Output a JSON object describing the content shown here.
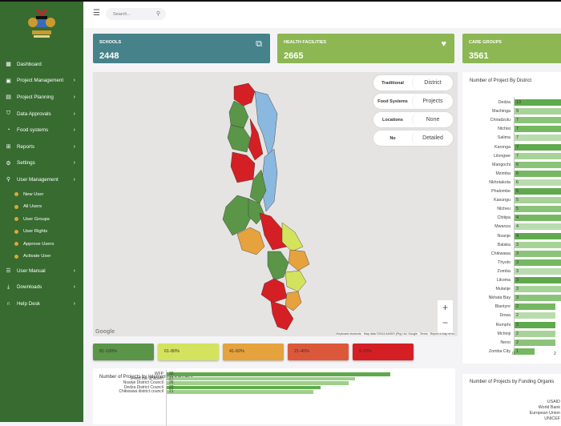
{
  "sidebar": {
    "items": [
      {
        "label": "Dashboard",
        "icon": "grid-icon",
        "glyph": "▦",
        "chev": false
      },
      {
        "label": "Project Management",
        "icon": "folder-icon",
        "glyph": "▣",
        "chev": true
      },
      {
        "label": "Project Planning",
        "icon": "calendar-icon",
        "glyph": "▤",
        "chev": true
      },
      {
        "label": "Data Approvals",
        "icon": "shield-icon",
        "glyph": "⛉",
        "chev": true
      },
      {
        "label": "Food systems",
        "icon": "food-icon",
        "glyph": "◔",
        "chev": true
      },
      {
        "label": "Reports",
        "icon": "reports-icon",
        "glyph": "⊞",
        "chev": true
      },
      {
        "label": "Settings",
        "icon": "gear-icon",
        "glyph": "⚙",
        "chev": true
      },
      {
        "label": "User Management",
        "icon": "user-icon",
        "glyph": "⚲",
        "chev": true
      }
    ],
    "sub_items": [
      "New User",
      "All Users",
      "User Groups",
      "User Rights",
      "Approve Users",
      "Activate User"
    ],
    "bottom_items": [
      {
        "label": "User Manual",
        "icon": "manual-icon",
        "glyph": "☰"
      },
      {
        "label": "Downloads",
        "icon": "download-icon",
        "glyph": "⤓"
      },
      {
        "label": "Help Desk",
        "icon": "headset-icon",
        "glyph": "∩"
      }
    ]
  },
  "header": {
    "search_placeholder": "Search..."
  },
  "cards": [
    {
      "title": "SCHOOLS",
      "value": "2448",
      "color": "#468289"
    },
    {
      "title": "HEALTH FACILITIES",
      "value": "2665",
      "color": "#8cb752"
    },
    {
      "title": "CARE GROUPS",
      "value": "3561",
      "color": "#8cb752"
    }
  ],
  "map": {
    "toggles": [
      [
        "Traditional",
        "District"
      ],
      [
        "Food Systems",
        "Projects"
      ],
      [
        "Locations",
        "None"
      ],
      [
        "No",
        "Detailed"
      ]
    ],
    "attribution": "Keyboard shortcuts   Map data ©2024 AfriGIS (Pty) Ltd, Google   Terms   Report a map error",
    "google": "Google",
    "zoom_in": "+",
    "zoom_out": "−"
  },
  "legend": [
    {
      "label": "81-100%",
      "color": "#5a9548"
    },
    {
      "label": "61-80%",
      "color": "#d3e35e"
    },
    {
      "label": "41-60%",
      "color": "#e5a23d"
    },
    {
      "label": "21-40%",
      "color": "#dc583a"
    },
    {
      "label": "0-20%",
      "color": "#d41f24"
    }
  ],
  "chart_data": [
    {
      "type": "bar",
      "title": "Number of Project By District",
      "categories": [
        "Dedza",
        "Machinga",
        "Chiradzulu",
        "Ntchisi",
        "Salima",
        "Karonga",
        "Lilongwe",
        "Mangochi",
        "Mzimba",
        "Nkhotakota",
        "Phalombe",
        "Kasungu",
        "Ntcheu",
        "Chitipa",
        "Mwanza",
        "Nsanje",
        "Balaka",
        "Chikwawa",
        "Thyolo",
        "Zomba",
        "Likoma",
        "Mulanje",
        "Nkhata Bay",
        "Blantyre",
        "Dowa",
        "Rumphi",
        "Mchinji",
        "Neno",
        "Zomba City"
      ],
      "values": [
        13,
        9,
        7,
        7,
        7,
        7,
        7,
        6,
        6,
        6,
        5,
        5,
        5,
        4,
        4,
        4,
        3,
        3,
        3,
        3,
        3,
        3,
        3,
        2,
        2,
        2,
        2,
        2,
        1
      ],
      "xticks": [
        "0",
        "2"
      ]
    },
    {
      "type": "bar",
      "title": "Number of Projects by Iplementing Partners",
      "categories": [
        "WFP",
        "Feed the Children",
        "Nsanje District Council",
        "Dedza District Council",
        "Chikwawa district council"
      ],
      "values": [
        32,
        27,
        26,
        22,
        21
      ]
    },
    {
      "type": "bar",
      "title": "Number of Projects by Funding Organis",
      "categories": [
        "USAID",
        "World Bank",
        "European Union",
        "UNICEF"
      ],
      "values": []
    }
  ]
}
